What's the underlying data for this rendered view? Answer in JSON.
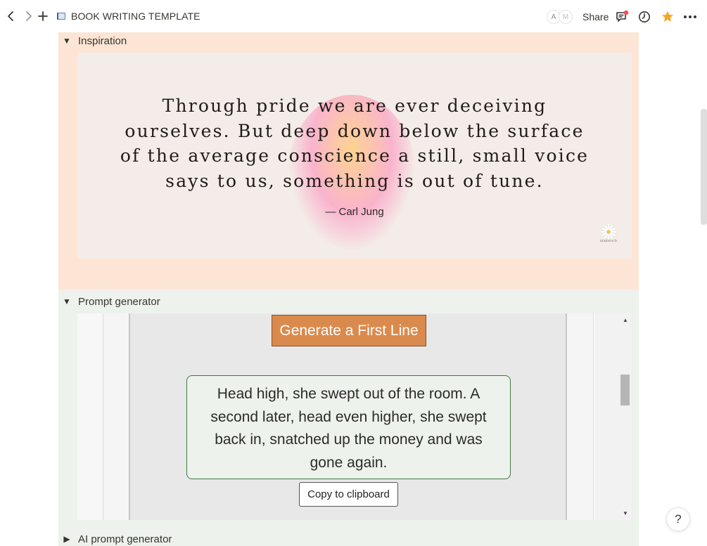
{
  "topbar": {
    "page_title": "BOOK WRITING TEMPLATE",
    "avatar_1": "A",
    "avatar_2": "M",
    "share_label": "Share"
  },
  "inspiration": {
    "label": "Inspiration",
    "quote": "Through pride we are ever deceiving ourselves. But deep down below the surface of the average conscience a still, small voice says to us, something is out of tune.",
    "author": "— Carl Jung",
    "logo_caption": "makisuch"
  },
  "prompt_generator": {
    "label": "Prompt generator",
    "generate_button": "Generate a First Line",
    "first_line": "Head high, she swept out of the room. A second later, head even higher, she swept back in, snatched up the money and was gone again.",
    "copy_button": "Copy to clipboard"
  },
  "ai_prompt_generator": {
    "label": "AI prompt generator"
  },
  "help": {
    "label": "?"
  },
  "colors": {
    "inspiration_bg": "#fce5d4",
    "prompt_bg": "#edf2ec",
    "generate_button": "#db8a4d",
    "favorite_star": "#f5a623",
    "notification_dot": "#eb5757"
  }
}
